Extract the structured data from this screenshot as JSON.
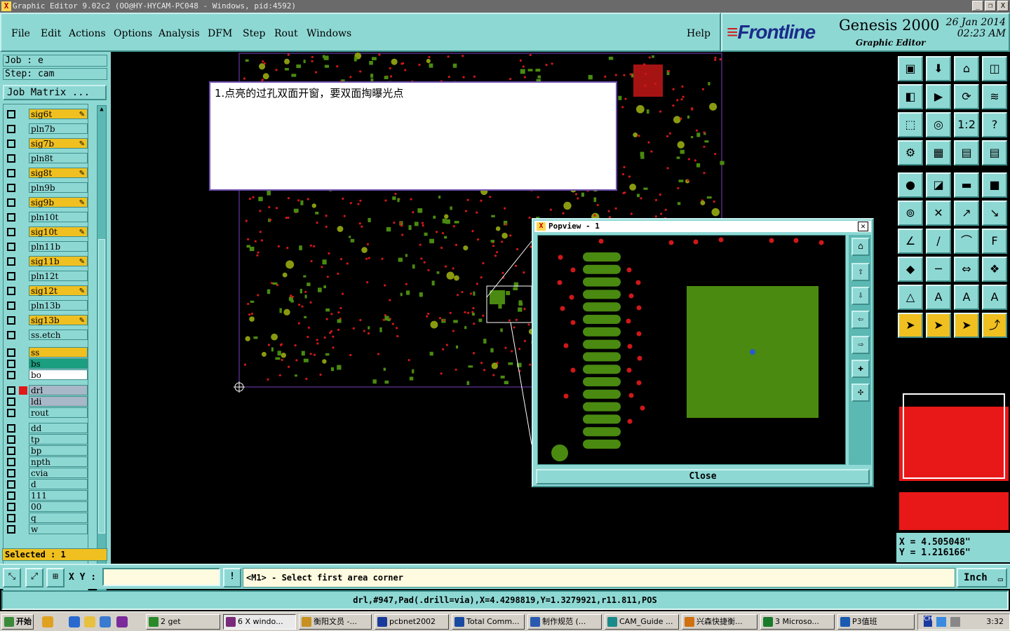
{
  "window": {
    "title": "Graphic Editor 9.02c2 (OO@HY-HYCAM-PC048 - Windows, pid:4592)",
    "buttons": [
      "_",
      "❐",
      "X"
    ]
  },
  "menu": {
    "items": [
      "File",
      "Edit",
      "Actions",
      "Options",
      "Analysis",
      "DFM",
      "Step",
      "Rout",
      "Windows"
    ],
    "help": "Help"
  },
  "brand": {
    "logo": "Frontline",
    "product": "Genesis 2000",
    "subtitle": "Graphic Editor",
    "date": "26 Jan 2014",
    "time": "02:23 AM"
  },
  "job": {
    "job_label": "Job : e",
    "step_label": "Step: cam",
    "job_matrix": "Job Matrix ..."
  },
  "layers": [
    {
      "name": "sig6t",
      "type": "sig"
    },
    {
      "name": "pln7b",
      "type": "pln"
    },
    {
      "name": "sig7b",
      "type": "sig"
    },
    {
      "name": "pln8t",
      "type": "pln"
    },
    {
      "name": "sig8t",
      "type": "sig"
    },
    {
      "name": "pln9b",
      "type": "pln"
    },
    {
      "name": "sig9b",
      "type": "sig"
    },
    {
      "name": "pln10t",
      "type": "pln"
    },
    {
      "name": "sig10t",
      "type": "sig"
    },
    {
      "name": "pln11b",
      "type": "pln"
    },
    {
      "name": "sig11b",
      "type": "sig"
    },
    {
      "name": "pln12t",
      "type": "pln"
    },
    {
      "name": "sig12t",
      "type": "sig"
    },
    {
      "name": "pln13b",
      "type": "pln"
    },
    {
      "name": "sig13b",
      "type": "sig"
    },
    {
      "name": "ss.etch",
      "type": "pln"
    },
    {
      "name": "ss",
      "type": "ss"
    },
    {
      "name": "bs",
      "type": "bs"
    },
    {
      "name": "bo",
      "type": "bo"
    },
    {
      "name": "drl",
      "type": "drl"
    },
    {
      "name": "ldi",
      "type": "drl"
    },
    {
      "name": "rout",
      "type": "rout"
    },
    {
      "name": "dd",
      "type": "pln"
    },
    {
      "name": "tp",
      "type": "pln"
    },
    {
      "name": "bp",
      "type": "pln"
    },
    {
      "name": "npth",
      "type": "pln"
    },
    {
      "name": "cvia",
      "type": "pln"
    },
    {
      "name": "d",
      "type": "pln"
    },
    {
      "name": "111",
      "type": "pln"
    },
    {
      "name": "00",
      "type": "pln"
    },
    {
      "name": "q",
      "type": "pln"
    },
    {
      "name": "w",
      "type": "pln"
    }
  ],
  "selected": "Selected : 1",
  "annotation": "1.点亮的过孔双面开窗，要双面掏曝光点",
  "popview": {
    "title": "Popview - 1",
    "close_label": "Close"
  },
  "coords": {
    "x": "X = 4.505048\"",
    "y": "Y = 1.216166\""
  },
  "bottom": {
    "xy_label": "X Y :",
    "xy_value": "",
    "prompt": "<M1> - Select first area corner",
    "units": "Inch",
    "status": "drl,#947,Pad(.drill=via),X=4.4298819,Y=1.3279921,r11.811,POS"
  },
  "taskbar": {
    "start": "开始",
    "items": [
      {
        "label": "2 get",
        "color": "#2a8a2a"
      },
      {
        "label": "6 X windo...",
        "color": "#7a2a7a"
      },
      {
        "label": "衡阳文员 -...",
        "color": "#c89020"
      },
      {
        "label": "pcbnet2002",
        "color": "#1a3a9a"
      },
      {
        "label": "Total Comm...",
        "color": "#1a4aa0"
      },
      {
        "label": "制作规范 (...",
        "color": "#2a5ab0"
      },
      {
        "label": "CAM_Guide ...",
        "color": "#1a8a8a"
      },
      {
        "label": "兴森快捷衡...",
        "color": "#d07010"
      },
      {
        "label": "3 Microso...",
        "color": "#1a7a2a"
      },
      {
        "label": "P3值班",
        "color": "#1a5ab0"
      }
    ],
    "clock": "3:32"
  },
  "colors": {
    "panel": "#8ed8d4",
    "signal_pad": "#d01818",
    "copper_pad": "#4a8a10",
    "via_center": "#2a5ad0",
    "layer_sig": "#f0c020"
  }
}
